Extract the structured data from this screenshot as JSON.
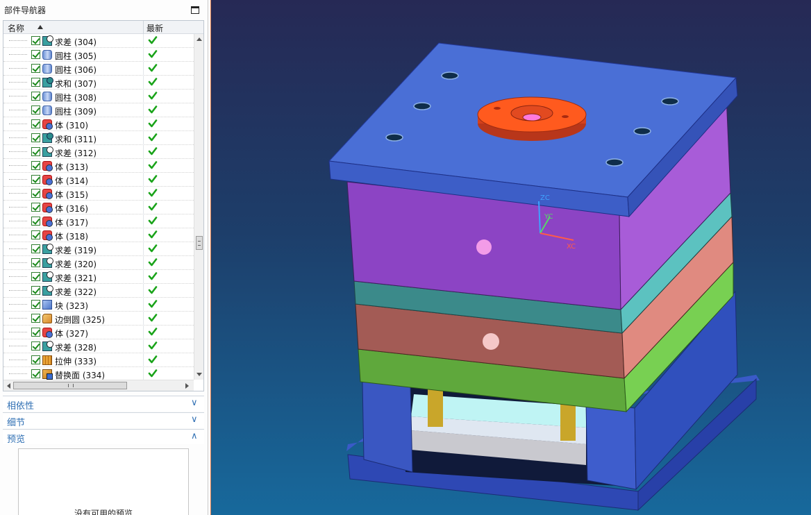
{
  "navigator": {
    "title": "部件导航器",
    "columns": {
      "name": "名称",
      "latest": "最新"
    },
    "rows": [
      {
        "icon": "subtract-icon",
        "label": "求差 (304)"
      },
      {
        "icon": "cylinder-icon",
        "label": "圆柱 (305)"
      },
      {
        "icon": "cylinder-icon",
        "label": "圆柱 (306)"
      },
      {
        "icon": "unite-icon",
        "label": "求和 (307)"
      },
      {
        "icon": "cylinder-icon",
        "label": "圆柱 (308)"
      },
      {
        "icon": "cylinder-icon",
        "label": "圆柱 (309)"
      },
      {
        "icon": "body-icon",
        "label": "体 (310)"
      },
      {
        "icon": "unite-icon",
        "label": "求和 (311)"
      },
      {
        "icon": "subtract-icon",
        "label": "求差 (312)"
      },
      {
        "icon": "body-icon",
        "label": "体 (313)"
      },
      {
        "icon": "body-icon",
        "label": "体 (314)"
      },
      {
        "icon": "body-icon",
        "label": "体 (315)"
      },
      {
        "icon": "body-icon",
        "label": "体 (316)"
      },
      {
        "icon": "body-icon",
        "label": "体 (317)"
      },
      {
        "icon": "body-icon",
        "label": "体 (318)"
      },
      {
        "icon": "subtract-icon",
        "label": "求差 (319)"
      },
      {
        "icon": "subtract-icon",
        "label": "求差 (320)"
      },
      {
        "icon": "subtract-icon",
        "label": "求差 (321)"
      },
      {
        "icon": "subtract-icon",
        "label": "求差 (322)"
      },
      {
        "icon": "block-icon",
        "label": "块 (323)"
      },
      {
        "icon": "edge-blend-icon",
        "label": "边倒圆 (325)"
      },
      {
        "icon": "body-icon",
        "label": "体 (327)"
      },
      {
        "icon": "subtract-icon",
        "label": "求差 (328)"
      },
      {
        "icon": "extrude-icon",
        "label": "拉伸 (333)"
      },
      {
        "icon": "replace-face-icon",
        "label": "替换面 (334)"
      }
    ]
  },
  "sections": {
    "dependencies": "相依性",
    "details": "细节",
    "preview": "预览",
    "preview_empty": "没有可用的预览"
  },
  "viewport": {
    "csys_labels": {
      "z": "ZC",
      "y": "YC",
      "x": "XC"
    },
    "colors": {
      "top_plate": "#4a6fd6",
      "a_plate": "#8c44c4",
      "stripper": "#3b8a8a",
      "b_plate": "#a05a55",
      "support": "#5fa83c",
      "locating_ring": "#ff5a1e"
    }
  }
}
